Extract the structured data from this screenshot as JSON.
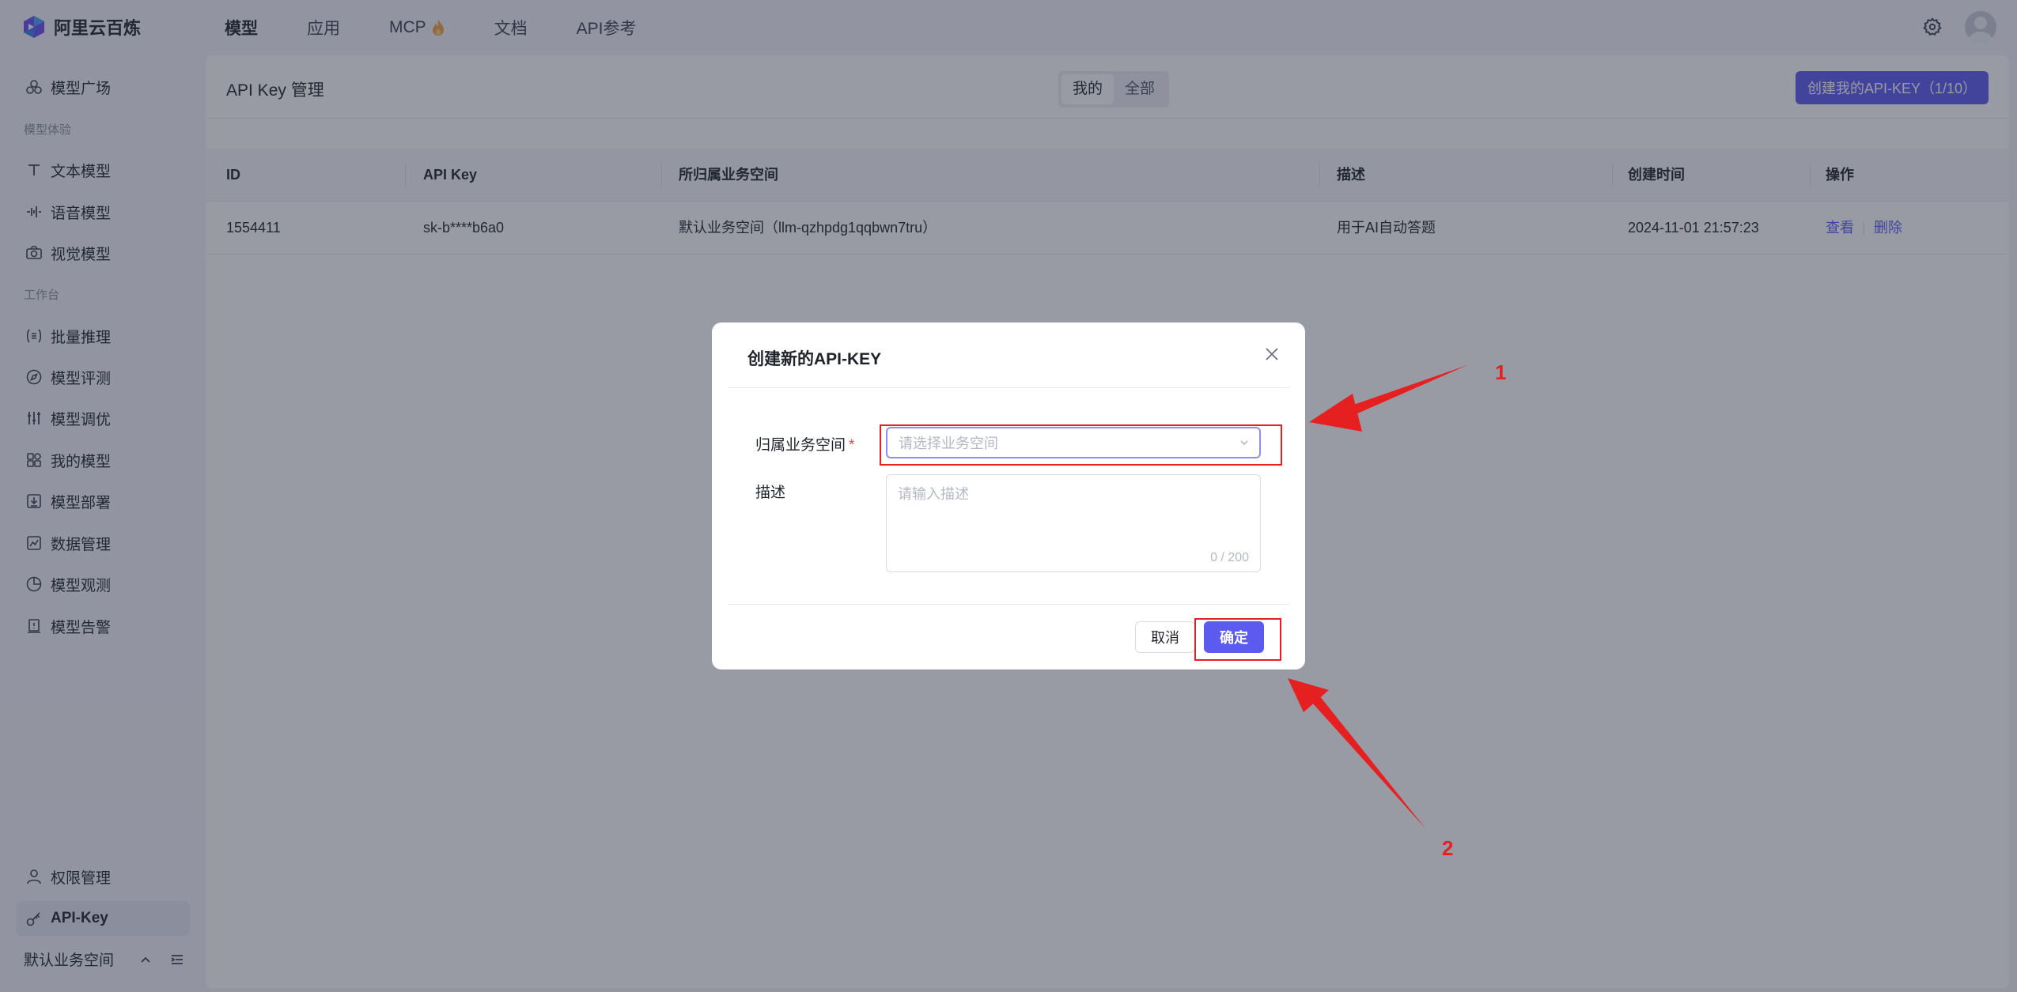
{
  "brand": {
    "name": "阿里云百炼"
  },
  "topnav": [
    {
      "label": "模型",
      "active": true
    },
    {
      "label": "应用"
    },
    {
      "label": "MCP"
    },
    {
      "label": "文档"
    },
    {
      "label": "API参考"
    }
  ],
  "sidebar": {
    "top_item": "模型广场",
    "group_experience": "模型体验",
    "experience_items": [
      "文本模型",
      "语音模型",
      "视觉模型"
    ],
    "group_workbench": "工作台",
    "workbench_items": [
      "批量推理",
      "模型评测",
      "模型调优",
      "我的模型",
      "模型部署",
      "数据管理",
      "模型观测",
      "模型告警"
    ],
    "bottom_items": [
      "权限管理",
      "API-Key"
    ],
    "workspace": "默认业务空间"
  },
  "page": {
    "title": "API Key 管理",
    "tabs": [
      "我的",
      "全部"
    ],
    "active_tab": "我的",
    "create_button": "创建我的API-KEY（1/10）"
  },
  "table": {
    "headers": [
      "ID",
      "API Key",
      "所归属业务空间",
      "描述",
      "创建时间",
      "操作"
    ],
    "rows": [
      {
        "id": "1554411",
        "key": "sk-b****b6a0",
        "workspace": "默认业务空间（llm-qzhpdg1qqbwn7tru）",
        "desc": "用于AI自动答题",
        "created": "2024-11-01 21:57:23",
        "actions": [
          "查看",
          "删除"
        ]
      }
    ]
  },
  "modal": {
    "title": "创建新的API-KEY",
    "workspace_label": "归属业务空间",
    "required_mark": "*",
    "workspace_placeholder": "请选择业务空间",
    "desc_label": "描述",
    "desc_placeholder": "请输入描述",
    "desc_counter": "0 / 200",
    "cancel": "取消",
    "confirm": "确定"
  },
  "annotations": [
    "1",
    "2"
  ],
  "colors": {
    "primary": "#5b5bf0",
    "annotation": "#e62020"
  }
}
